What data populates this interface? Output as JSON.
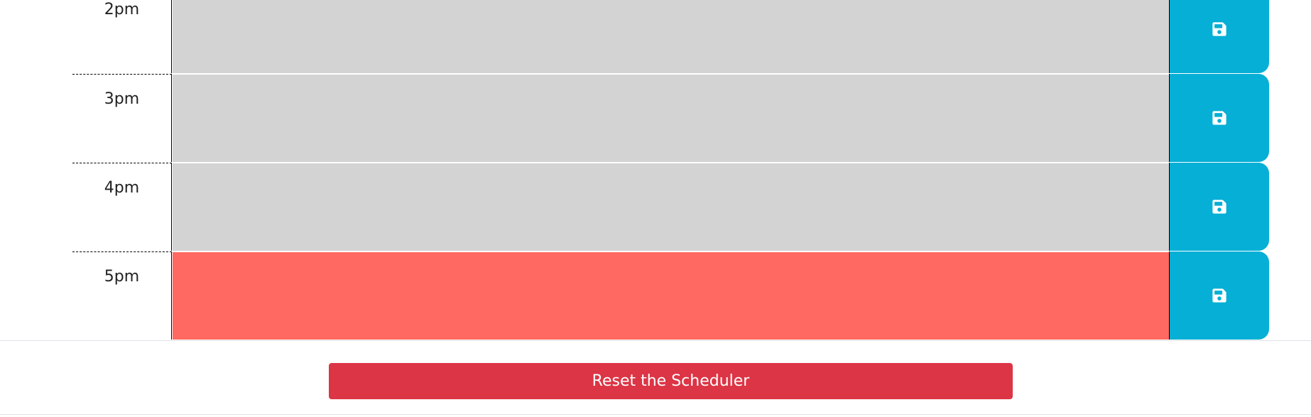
{
  "scheduler": {
    "rows": [
      {
        "hour": "2pm",
        "status": "past",
        "description": ""
      },
      {
        "hour": "3pm",
        "status": "past",
        "description": ""
      },
      {
        "hour": "4pm",
        "status": "past",
        "description": ""
      },
      {
        "hour": "5pm",
        "status": "present",
        "description": ""
      }
    ],
    "save_icon": "save-icon"
  },
  "footer": {
    "reset_label": "Reset the Scheduler"
  },
  "colors": {
    "past": "#d3d3d3",
    "present": "#ff6961",
    "save_button": "#06afd5",
    "reset_button": "#dc3545"
  }
}
